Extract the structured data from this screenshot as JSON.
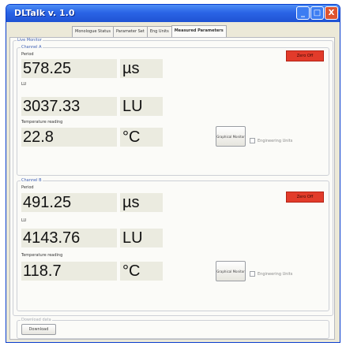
{
  "window": {
    "title": "DLTalk v. 1.0",
    "minimize": "_",
    "maximize": "□",
    "close": "X"
  },
  "tabs": [
    {
      "label": "Monologue Status",
      "active": false
    },
    {
      "label": "Parameter Set",
      "active": false
    },
    {
      "label": "Eng Units",
      "active": false
    },
    {
      "label": "Measured Parameters",
      "active": true
    }
  ],
  "live_monitor": {
    "title": "Live Monitor",
    "channel_a": {
      "title": "Channel A",
      "zero_button": "Zero Off",
      "period_label": "Period",
      "period_value": "578.25",
      "period_unit": "µs",
      "lu_label": "LU",
      "lu_value": "3037.33",
      "lu_unit": "LU",
      "temp_label": "Temperature reading",
      "temp_value": "22.8",
      "temp_unit": "°C",
      "graph_button": "Graphical Monitor",
      "eng_units_label": "Engineering Units",
      "eng_units_checked": false
    },
    "channel_b": {
      "title": "Channel B",
      "zero_button": "Zero Off",
      "period_label": "Period",
      "period_value": "491.25",
      "period_unit": "µs",
      "lu_label": "LU",
      "lu_value": "4143.76",
      "lu_unit": "LU",
      "temp_label": "Temperature reading",
      "temp_value": "118.7",
      "temp_unit": "°C",
      "graph_button": "Graphical Monitor",
      "eng_units_label": "Engineering Units",
      "eng_units_checked": false
    }
  },
  "download": {
    "title": "Download data",
    "button": "Download"
  },
  "colors": {
    "titlebar": "#2a64e6",
    "zero_button": "#e23b2a",
    "value_field": "#ebebe0",
    "group_title": "#3d5fb4"
  },
  "icons": {
    "close": "close-icon",
    "minimize": "minimize-icon",
    "maximize": "maximize-icon"
  }
}
